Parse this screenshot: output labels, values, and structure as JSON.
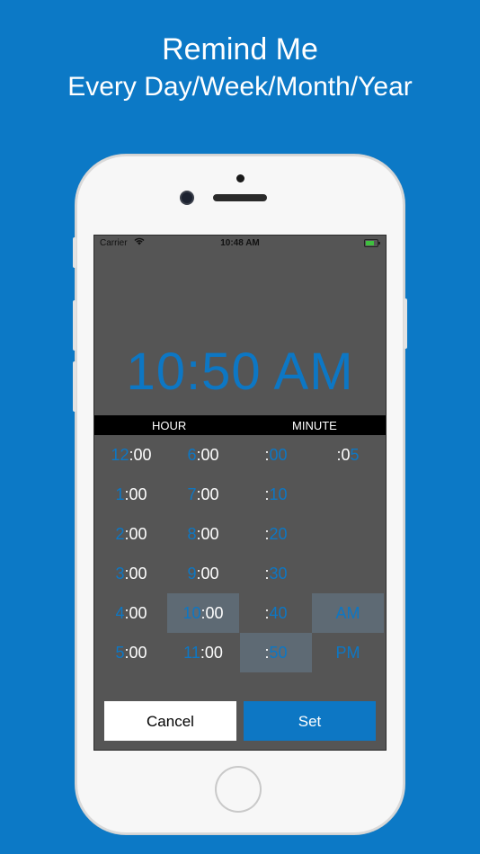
{
  "headline": {
    "line1": "Remind Me",
    "line2": "Every Day/Week/Month/Year"
  },
  "status_bar": {
    "carrier": "Carrier",
    "time": "10:48 AM"
  },
  "display_time": "10:50 AM",
  "picker": {
    "hour_header": "HOUR",
    "minute_header": "MINUTE",
    "hours_col1": [
      {
        "num": "12",
        "suffix": ":00"
      },
      {
        "num": "1",
        "suffix": ":00"
      },
      {
        "num": "2",
        "suffix": ":00"
      },
      {
        "num": "3",
        "suffix": ":00"
      },
      {
        "num": "4",
        "suffix": ":00"
      },
      {
        "num": "5",
        "suffix": ":00"
      }
    ],
    "hours_col2": [
      {
        "num": "6",
        "suffix": ":00"
      },
      {
        "num": "7",
        "suffix": ":00"
      },
      {
        "num": "8",
        "suffix": ":00"
      },
      {
        "num": "9",
        "suffix": ":00"
      },
      {
        "num": "10",
        "suffix": ":00"
      },
      {
        "num": "11",
        "suffix": ":00"
      }
    ],
    "minutes_col1": [
      {
        "prefix": ":",
        "num": "00"
      },
      {
        "prefix": ":",
        "num": "10"
      },
      {
        "prefix": ":",
        "num": "20"
      },
      {
        "prefix": ":",
        "num": "30"
      },
      {
        "prefix": ":",
        "num": "40"
      },
      {
        "prefix": ":",
        "num": "50"
      }
    ],
    "minute_offset": {
      "prefix": ":0",
      "num": "5"
    },
    "am_label": "AM",
    "pm_label": "PM"
  },
  "buttons": {
    "cancel": "Cancel",
    "set": "Set"
  },
  "colors": {
    "background": "#0c79c6",
    "accent": "#0d77c4",
    "screen": "#555555",
    "selected": "#5e6a74"
  }
}
